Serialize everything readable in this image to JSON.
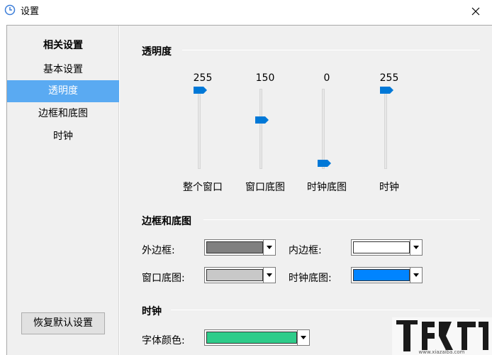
{
  "window": {
    "title": "设置",
    "icon": "clock-icon",
    "close": "close-icon"
  },
  "sidebar": {
    "heading": "相关设置",
    "items": [
      {
        "label": "基本设置",
        "active": false
      },
      {
        "label": "透明度",
        "active": true
      },
      {
        "label": "边框和底图",
        "active": false
      },
      {
        "label": "时钟",
        "active": false
      }
    ],
    "restore_button": "恢复默认设置",
    "active_color": "#5aaaf2"
  },
  "transparency": {
    "title": "透明度",
    "sliders": [
      {
        "label": "整个窗口",
        "value": "255",
        "level": 255,
        "max": 255
      },
      {
        "label": "窗口底图",
        "value": "150",
        "level": 150,
        "max": 255
      },
      {
        "label": "时钟底图",
        "value": "0",
        "level": 0,
        "max": 255
      },
      {
        "label": "时钟",
        "value": "255",
        "level": 255,
        "max": 255
      }
    ],
    "thumb_color": "#0078d7"
  },
  "border": {
    "title": "边框和底图",
    "fields": [
      {
        "label": "外边框:",
        "color": "#808080"
      },
      {
        "label": "内边框:",
        "color": "#ffffff"
      },
      {
        "label": "窗口底图:",
        "color": "#c8c8c8"
      },
      {
        "label": "时钟底图:",
        "color": "#0084ff"
      }
    ]
  },
  "clock": {
    "title": "时钟",
    "fields": [
      {
        "label": "字体颜色:",
        "color": "#2ecc8a"
      }
    ]
  },
  "watermark": {
    "text": "www.xiazaiba.com"
  }
}
